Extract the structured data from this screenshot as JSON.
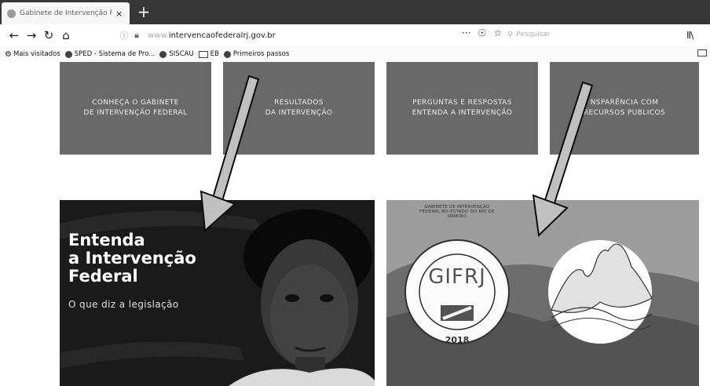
{
  "browser": {
    "tab_title": "Gabinete de Intervenção Fed",
    "tab_close": "×",
    "new_tab": "+",
    "nav": {
      "back": "←",
      "forward": "→",
      "reload": "↻",
      "home": "⌂"
    },
    "url_prefix": "www.",
    "url_domain": "intervencaofederalrj.gov.br",
    "nav_right": {
      "more": "···",
      "pocket": "☉",
      "star": "☆"
    },
    "search_placeholder": "Pesquisar",
    "library": "II\\",
    "bookmarks": [
      {
        "label": "Mais visitados",
        "icon": "gear-icon"
      },
      {
        "label": "SPED - Sistema de Pro...",
        "icon": "globe-icon"
      },
      {
        "label": "SISCAU",
        "icon": "globe-icon"
      },
      {
        "label": "EB",
        "icon": "folder-icon"
      },
      {
        "label": "Primeiros passos",
        "icon": "globe-icon"
      }
    ]
  },
  "cards": [
    {
      "line1": "CONHEÇA O GABINETE",
      "line2": "DE INTERVENÇÃO FEDERAL"
    },
    {
      "line1": "RESULTADOS",
      "line2": "DA INTERVENÇÃO"
    },
    {
      "line1": "PERGUNTAS E RESPOSTAS",
      "line2": "ENTENDA A INTERVENÇÃO"
    },
    {
      "line1": "NSPARÊNCIA COM",
      "line2": "RECURSOS PUBLICOS"
    }
  ],
  "banner_left": {
    "title_line1": "Entenda",
    "title_line2": "a Intervenção",
    "title_line3": "Federal",
    "subtitle": "O que diz a legislação"
  },
  "banner_right": {
    "seal_text": "GABINETE DE INTERVENÇÃO FEDERAL NO ESTADO DO RIO DE JANEIRO",
    "seal_acronym": "GIFRJ",
    "seal_year": "2018"
  },
  "colors": {
    "tabbar": "#3a3a3a",
    "card": "#6a6a6a",
    "banner_dark": "#1f1f1f"
  }
}
